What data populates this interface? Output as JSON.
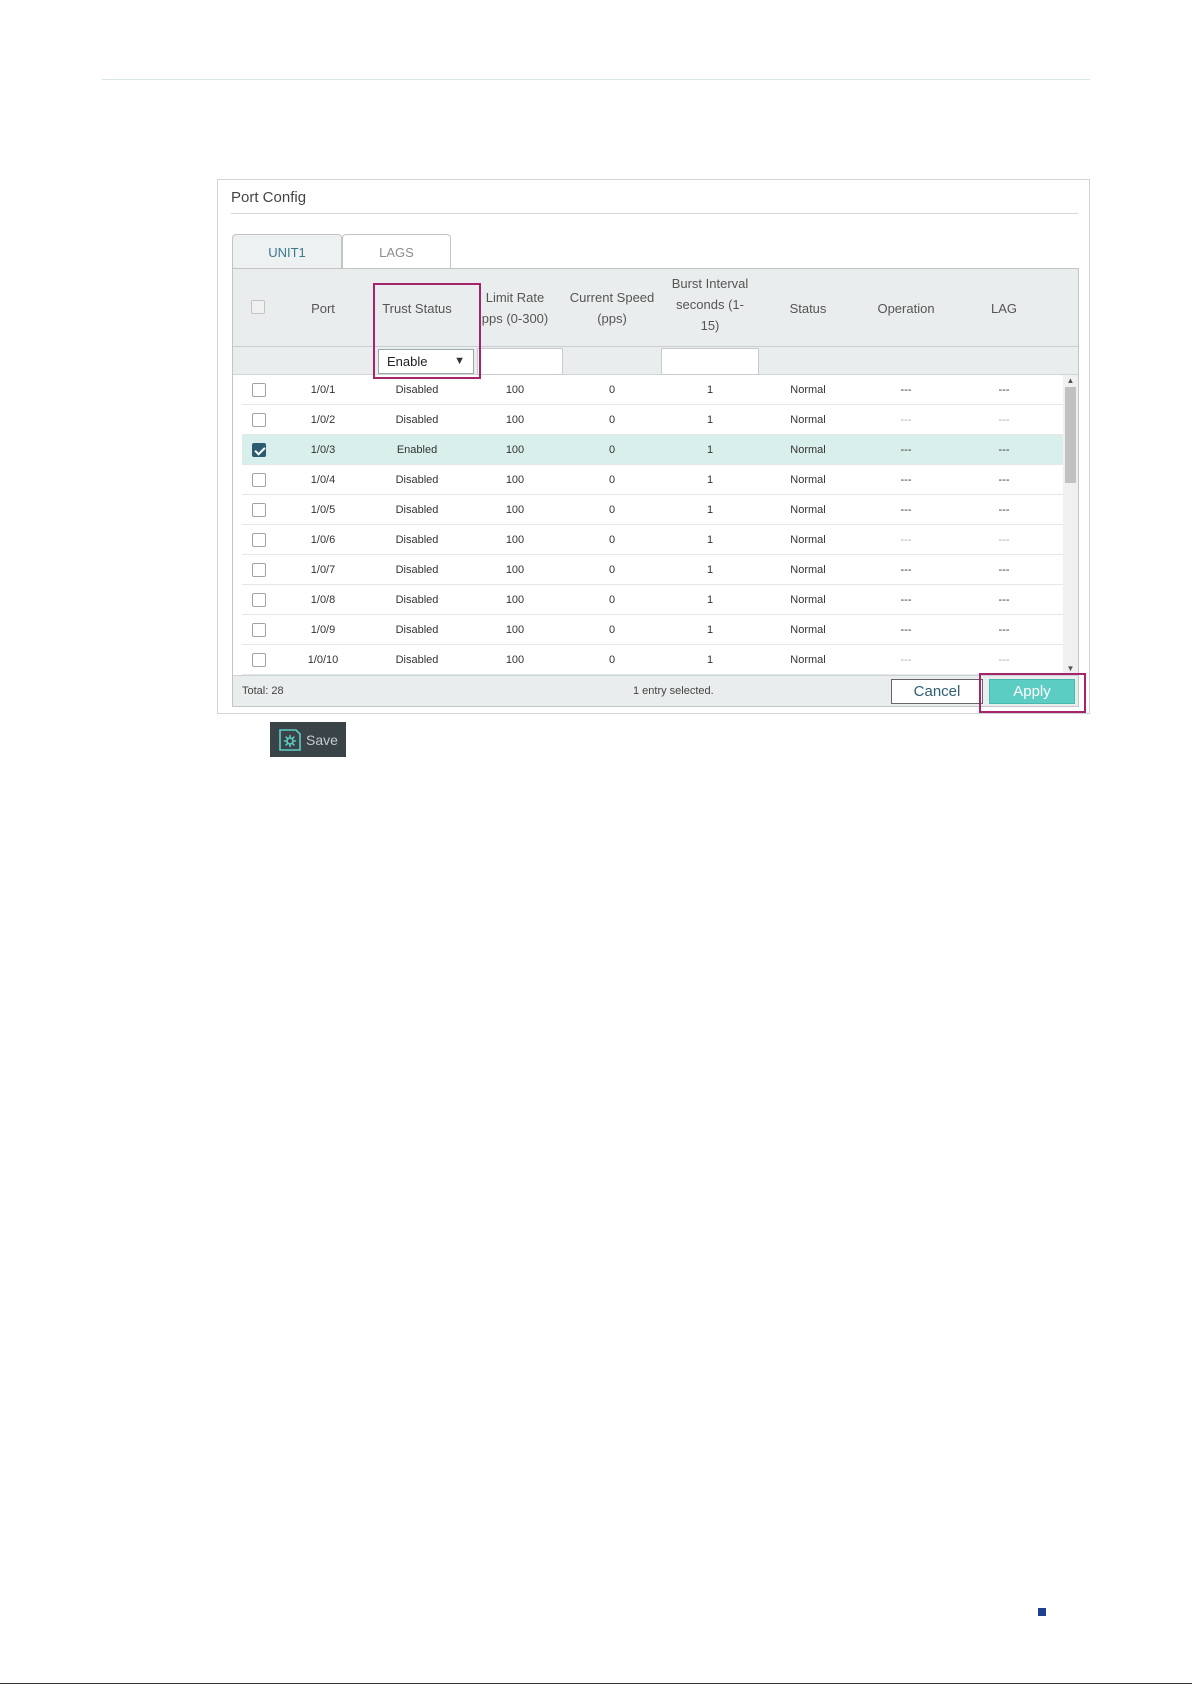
{
  "panel": {
    "title": "Port Config"
  },
  "tabs": [
    {
      "label": "UNIT1",
      "active": true
    },
    {
      "label": "LAGS",
      "active": false
    }
  ],
  "columns": {
    "port": "Port",
    "trust_status": "Trust Status",
    "limit_rate_1": "Limit Rate",
    "limit_rate_2": "pps (0-300)",
    "current_speed_1": "Current Speed",
    "current_speed_2": "(pps)",
    "burst_1": "Burst Interval",
    "burst_2": "seconds (1-",
    "burst_3": "15)",
    "status": "Status",
    "operation": "Operation",
    "lag": "LAG"
  },
  "filter": {
    "trust_status_value": "Enable",
    "arrow": "▼"
  },
  "rows": [
    {
      "port": "1/0/1",
      "trust": "Disabled",
      "limit": "100",
      "speed": "0",
      "burst": "1",
      "status": "Normal",
      "operation": "---",
      "lag": "---",
      "checked": false
    },
    {
      "port": "1/0/2",
      "trust": "Disabled",
      "limit": "100",
      "speed": "0",
      "burst": "1",
      "status": "Normal",
      "operation": "---",
      "lag": "---",
      "checked": false
    },
    {
      "port": "1/0/3",
      "trust": "Enabled",
      "limit": "100",
      "speed": "0",
      "burst": "1",
      "status": "Normal",
      "operation": "---",
      "lag": "---",
      "checked": true
    },
    {
      "port": "1/0/4",
      "trust": "Disabled",
      "limit": "100",
      "speed": "0",
      "burst": "1",
      "status": "Normal",
      "operation": "---",
      "lag": "---",
      "checked": false
    },
    {
      "port": "1/0/5",
      "trust": "Disabled",
      "limit": "100",
      "speed": "0",
      "burst": "1",
      "status": "Normal",
      "operation": "---",
      "lag": "---",
      "checked": false
    },
    {
      "port": "1/0/6",
      "trust": "Disabled",
      "limit": "100",
      "speed": "0",
      "burst": "1",
      "status": "Normal",
      "operation": "---",
      "lag": "---",
      "checked": false
    },
    {
      "port": "1/0/7",
      "trust": "Disabled",
      "limit": "100",
      "speed": "0",
      "burst": "1",
      "status": "Normal",
      "operation": "---",
      "lag": "---",
      "checked": false
    },
    {
      "port": "1/0/8",
      "trust": "Disabled",
      "limit": "100",
      "speed": "0",
      "burst": "1",
      "status": "Normal",
      "operation": "---",
      "lag": "---",
      "checked": false
    },
    {
      "port": "1/0/9",
      "trust": "Disabled",
      "limit": "100",
      "speed": "0",
      "burst": "1",
      "status": "Normal",
      "operation": "---",
      "lag": "---",
      "checked": false
    },
    {
      "port": "1/0/10",
      "trust": "Disabled",
      "limit": "100",
      "speed": "0",
      "burst": "1",
      "status": "Normal",
      "operation": "---",
      "lag": "---",
      "checked": false
    }
  ],
  "footer": {
    "total": "Total: 28",
    "selected": "1 entry selected.",
    "cancel_label": "Cancel",
    "apply_label": "Apply"
  },
  "save": {
    "label": "Save",
    "icon": "save-gear-icon"
  },
  "colors": {
    "accent": "#5ccdc3",
    "highlight": "#a5246b",
    "selected_row": "#d9efeb",
    "tab_active_text": "#3a7a8c"
  }
}
